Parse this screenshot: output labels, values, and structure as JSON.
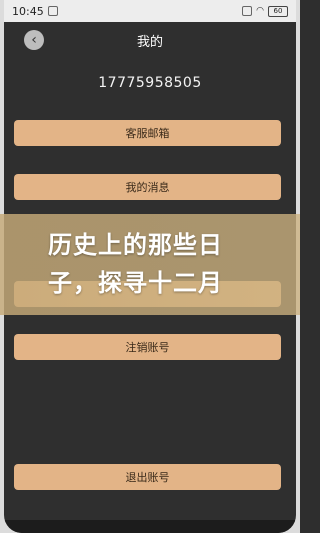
{
  "status_bar": {
    "time": "10:45",
    "battery": "60"
  },
  "nav": {
    "back_icon": "chevron-left-icon",
    "title": "我的"
  },
  "account": {
    "phone": "17775958505"
  },
  "menu": {
    "customer_service": "客服邮箱",
    "my_messages": "我的消息",
    "cancel_account": "注销账号",
    "logout": "退出账号"
  },
  "overlay": {
    "line1": "历史上的那些日",
    "line2": "子，探寻十二月"
  },
  "colors": {
    "button": "#e3b487",
    "background": "#2f2f2f"
  }
}
